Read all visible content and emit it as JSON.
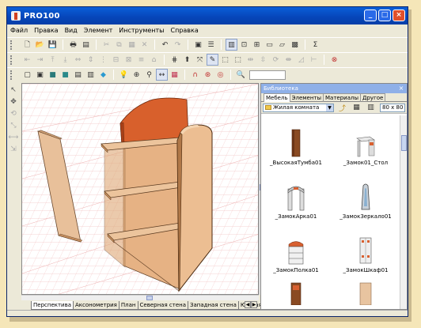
{
  "window": {
    "title": "PRO100",
    "buttons": {
      "minimize": "_",
      "maximize": "□",
      "close": "×"
    }
  },
  "menu": [
    "Файл",
    "Правка",
    "Вид",
    "Элемент",
    "Инструменты",
    "Справка"
  ],
  "view_tabs": [
    "Перспектива",
    "Аксонометрия",
    "План",
    "Северная стена",
    "Западная стена",
    "Южная стена"
  ],
  "active_view_tab": 0,
  "library": {
    "title": "Библиотека",
    "close": "×",
    "tabs": [
      "Мебель",
      "Элементы",
      "Материалы",
      "Другое"
    ],
    "active_tab": 0,
    "folder": "Жилая комната",
    "icon_size": "80 x 80",
    "items": [
      {
        "label": "_ВысокаяТумба01",
        "icon": "tall-cabinet-icon"
      },
      {
        "label": "_Замок01_Стол",
        "icon": "desk-icon"
      },
      {
        "label": "_ЗамокАрка01",
        "icon": "arch-icon"
      },
      {
        "label": "_ЗамокЗеркало01",
        "icon": "mirror-icon"
      },
      {
        "label": "_ЗамокПолка01",
        "icon": "shelf-icon"
      },
      {
        "label": "_ЗамокШкаф01",
        "icon": "wardrobe-icon"
      },
      {
        "label": "",
        "icon": "cabinet-icon"
      },
      {
        "label": "",
        "icon": "cabinet-icon"
      }
    ]
  },
  "colors": {
    "titlebar": "#0645b8",
    "wood_light": "#e8b888",
    "wood_dark": "#c8905c",
    "headboard": "#d86030",
    "grid": "#f2b8b8"
  }
}
